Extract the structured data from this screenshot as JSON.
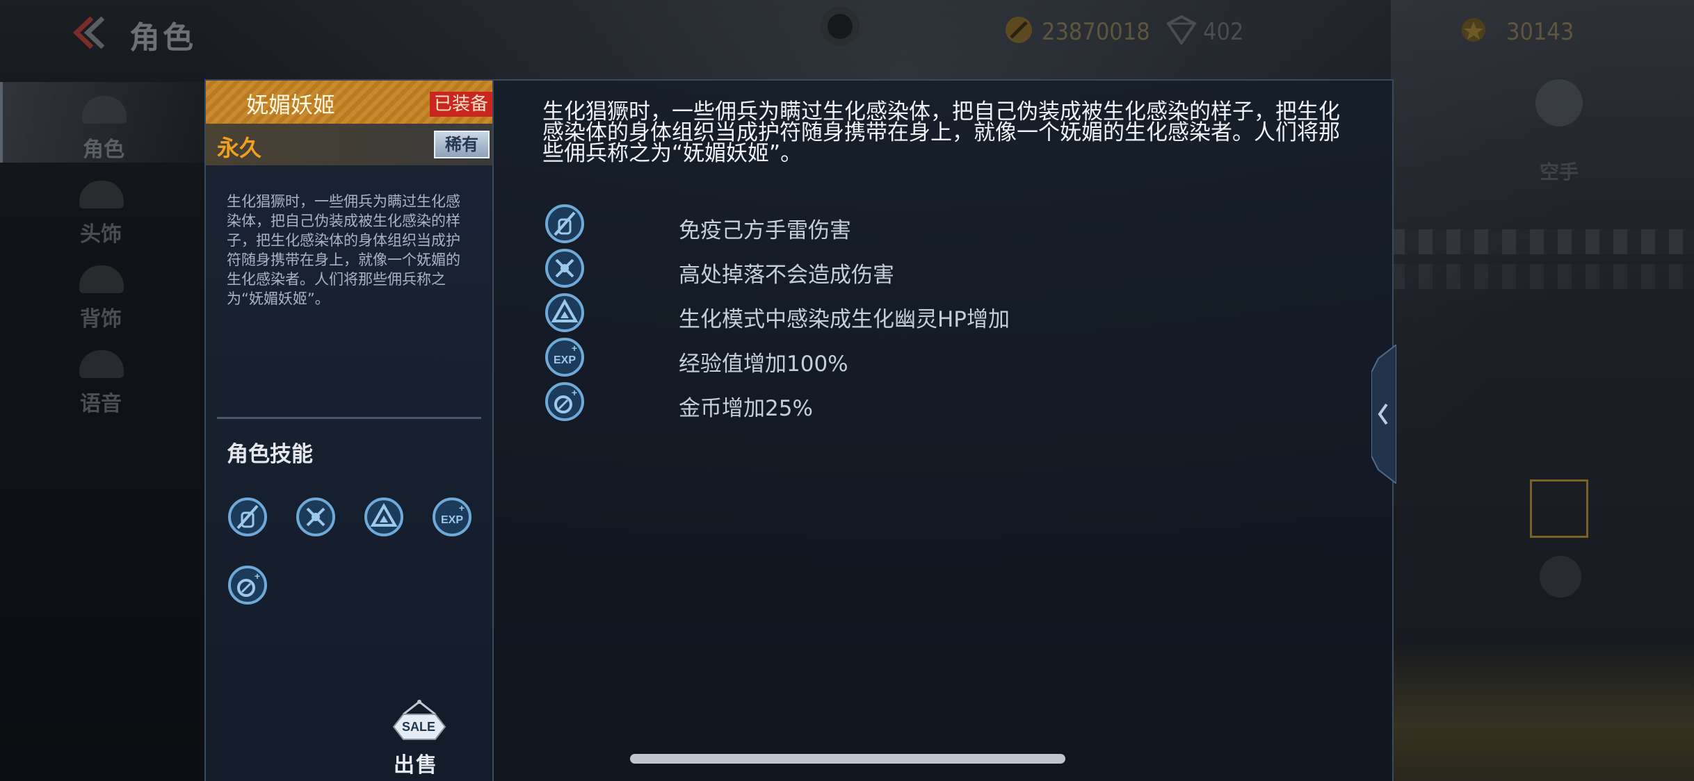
{
  "header": {
    "title": "角色",
    "currencies": [
      {
        "icon": "gold-coin-icon",
        "value": "23870018"
      },
      {
        "icon": "diamond-icon",
        "value": "402"
      },
      {
        "icon": "honor-coin-icon",
        "value": "30143"
      }
    ]
  },
  "sidebar": {
    "items": [
      {
        "label": "角色",
        "icon": "character-icon",
        "active": true
      },
      {
        "label": "头饰",
        "icon": "headwear-icon",
        "active": false
      },
      {
        "label": "背饰",
        "icon": "backwear-icon",
        "active": false
      },
      {
        "label": "语音",
        "icon": "voice-icon",
        "active": false
      }
    ]
  },
  "right_controls": {
    "gamepad_label": "空手"
  },
  "item": {
    "name": "妩媚妖姬",
    "equipped_label": "已装备",
    "duration": "永久",
    "rarity": "稀有",
    "short_description": "生化猖獗时，一些佣兵为瞒过生化感染体，把自己伪装成被生化感染的样子，把生化感染体的身体组织当成护符随身携带在身上，就像一个妩媚的生化感染者。人们将那些佣兵称之为“妩媚妖姬”。",
    "long_description": "生化猖獗时，一些佣兵为瞒过生化感染体，把自己伪装成被生化感染的样子，把生化感染体的身体组织当成护符随身携带在身上，就像一个妩媚的生化感染者。人们将那些佣兵称之为“妩媚妖姬”。",
    "skills_title": "角色技能",
    "sell_label": "出售",
    "sale_sign": "SALE"
  },
  "features": [
    {
      "icon": "grenade-immune-icon",
      "text": "免疫己方手雷伤害"
    },
    {
      "icon": "fall-damage-icon",
      "text": "高处掉落不会造成伤害"
    },
    {
      "icon": "ghost-hp-icon",
      "text": "生化模式中感染成生化幽灵HP增加"
    },
    {
      "icon": "exp-boost-icon",
      "text": "经验值增加100%"
    },
    {
      "icon": "coin-boost-icon",
      "text": "金币增加25%"
    }
  ],
  "colors": {
    "panel_border": "#3a4a5e",
    "name_bar": "#c98a2e",
    "equipped_tag": "#c8261e",
    "duration_text": "#f0a020",
    "icon_blue": "#6fa9d8"
  }
}
